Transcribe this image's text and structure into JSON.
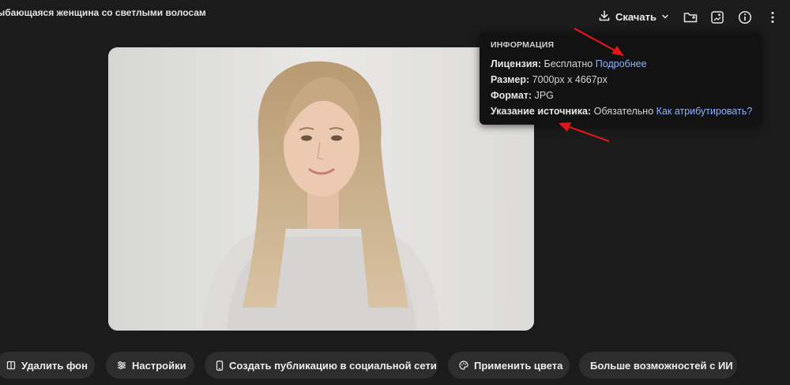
{
  "header": {
    "title": "ыбающаяся женщина со светлыми волосами, о...",
    "download_label": "Скачать"
  },
  "toolbar_icons": [
    "download-icon",
    "chevron-down-icon",
    "folder-icon",
    "collection-icon",
    "info-icon",
    "more-icon"
  ],
  "info_panel": {
    "heading": "ИНФОРМАЦИЯ",
    "license_label": "Лицензия:",
    "license_value": "Бесплатно",
    "license_link": "Подробнее",
    "size_label": "Размер:",
    "size_value": "7000px x 4667px",
    "format_label": "Формат:",
    "format_value": "JPG",
    "attribution_label": "Указание источника:",
    "attribution_value": "Обязательно",
    "attribution_link": "Как атрибутировать?"
  },
  "actions": [
    {
      "label": "Удалить фон",
      "icon": "remove-background-icon"
    },
    {
      "label": "Настройки",
      "icon": "sliders-icon"
    },
    {
      "label": "Создать публикацию в социальной сети",
      "icon": "phone-icon"
    },
    {
      "label": "Применить цвета",
      "icon": "palette-icon"
    },
    {
      "label": "Больше возможностей с ИИ",
      "icon": ""
    }
  ],
  "colors": {
    "background": "#1b1b1b",
    "panel": "#121212",
    "pill": "#2d2d2d",
    "link": "#8fb3ff",
    "annotation_arrow": "#e0161b"
  }
}
